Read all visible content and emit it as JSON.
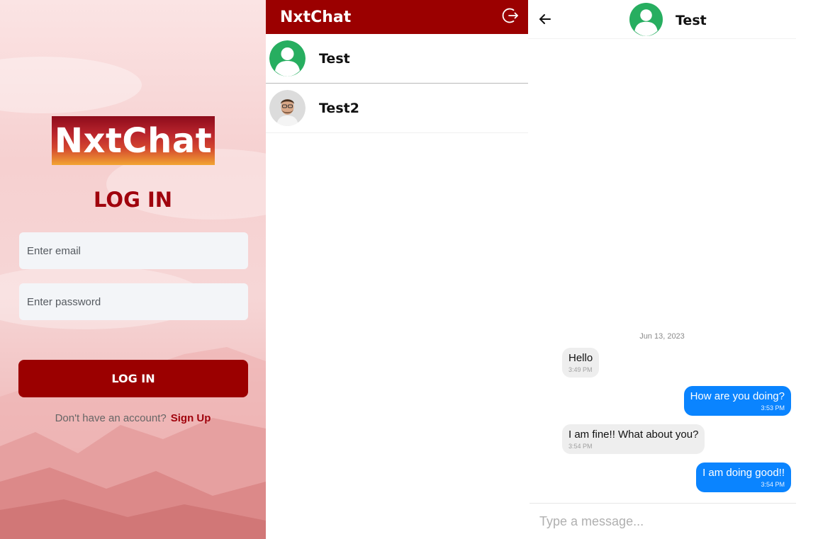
{
  "login": {
    "logo_text": "NxtChat",
    "heading": "LOG IN",
    "email_placeholder": "Enter email",
    "password_placeholder": "Enter password",
    "button_label": "LOG IN",
    "signup_prompt": "Don't have an account?",
    "signup_link": "Sign Up"
  },
  "chat_list": {
    "title": "NxtChat",
    "logout_icon": "logout-icon",
    "contacts": [
      {
        "name": "Test",
        "avatar": "default-user-avatar"
      },
      {
        "name": "Test2",
        "avatar": "photo-avatar"
      }
    ]
  },
  "conversation": {
    "contact_name": "Test",
    "back_icon": "arrow-left-icon",
    "date_separator": "Jun 13, 2023",
    "messages": [
      {
        "direction": "incoming",
        "text": "Hello",
        "time": "3:49 PM"
      },
      {
        "direction": "outgoing",
        "text": "How are you doing?",
        "time": "3:53 PM"
      },
      {
        "direction": "incoming",
        "text": "I am fine!! What about you?",
        "time": "3:54 PM"
      },
      {
        "direction": "outgoing",
        "text": "I am doing good!!",
        "time": "3:54 PM"
      }
    ],
    "composer_placeholder": "Type a message..."
  },
  "colors": {
    "brand_red": "#9b0000",
    "outgoing_bubble": "#0a84ff",
    "incoming_bubble": "#eeeeee",
    "avatar_green": "#27ae60"
  }
}
